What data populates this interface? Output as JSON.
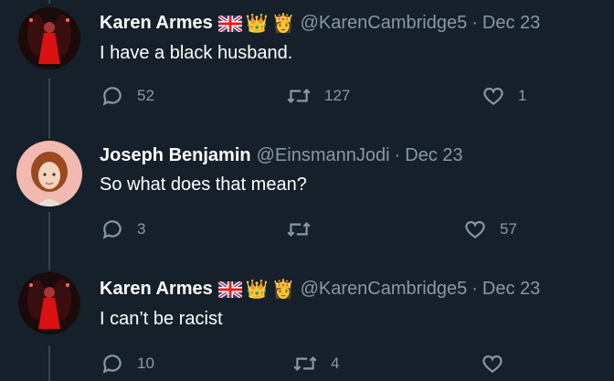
{
  "tweets": [
    {
      "name": "Karen Armes",
      "emojis": [
        "uk-flag",
        "crown",
        "princess"
      ],
      "handle": "@KarenCambridge5",
      "date": "Dec 23",
      "text": "I have a black husband.",
      "replies": "52",
      "retweets": "127",
      "likes": "1"
    },
    {
      "name": "Joseph Benjamin",
      "emojis": [],
      "handle": "@EinsmannJodi",
      "date": "Dec 23",
      "text": "So what does that mean?",
      "replies": "3",
      "retweets": "",
      "likes": "57"
    },
    {
      "name": "Karen Armes",
      "emojis": [
        "uk-flag",
        "crown",
        "princess"
      ],
      "handle": "@KarenCambridge5",
      "date": "Dec 23",
      "text": "I can’t be racist",
      "replies": "10",
      "retweets": "4",
      "likes": ""
    }
  ],
  "separator": "·",
  "colors": {
    "background": "#15202b",
    "secondary_text": "#8899a6",
    "thread_line": "#38444d"
  }
}
